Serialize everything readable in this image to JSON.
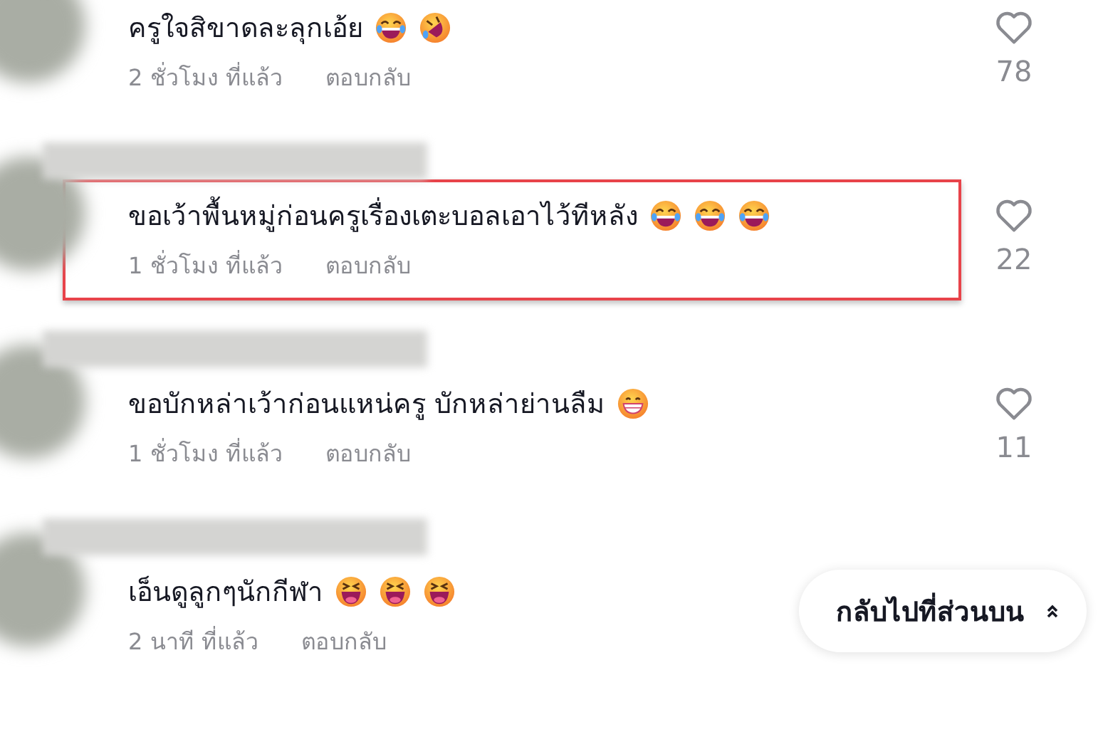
{
  "comments": [
    {
      "highlighted": false,
      "text": "ครูใจสิขาดละลุกเอ้ย",
      "emojis": [
        {
          "kind": "tears-of-joy"
        },
        {
          "kind": "rolling-laughing"
        }
      ],
      "time": "2 ชั่วโมง ที่แล้ว",
      "reply": "ตอบกลับ",
      "likes": "78"
    },
    {
      "highlighted": true,
      "text": "ขอเว้าพื้นหมู่ก่อนครูเรื่องเตะบอลเอาไว้ทีหลัง",
      "emojis": [
        {
          "kind": "tears-of-joy"
        },
        {
          "kind": "tears-of-joy"
        },
        {
          "kind": "tears-of-joy"
        }
      ],
      "time": "1 ชั่วโมง ที่แล้ว",
      "reply": "ตอบกลับ",
      "likes": "22"
    },
    {
      "highlighted": false,
      "text": "ขอบักหล่าเว้าก่อนแหน่ครู บักหล่าย่านลืม",
      "emojis": [
        {
          "kind": "grinning"
        }
      ],
      "time": "1 ชั่วโมง ที่แล้ว",
      "reply": "ตอบกลับ",
      "likes": "11"
    },
    {
      "highlighted": false,
      "text": "เอ็นดูลูกๆนักกีฬา",
      "emojis": [
        {
          "kind": "squinting"
        },
        {
          "kind": "squinting"
        },
        {
          "kind": "squinting"
        }
      ],
      "time": "2 นาที ที่แล้ว",
      "reply": "ตอบกลับ"
    }
  ],
  "back_to_top": {
    "label": "กลับไปที่ส่วนบน"
  }
}
